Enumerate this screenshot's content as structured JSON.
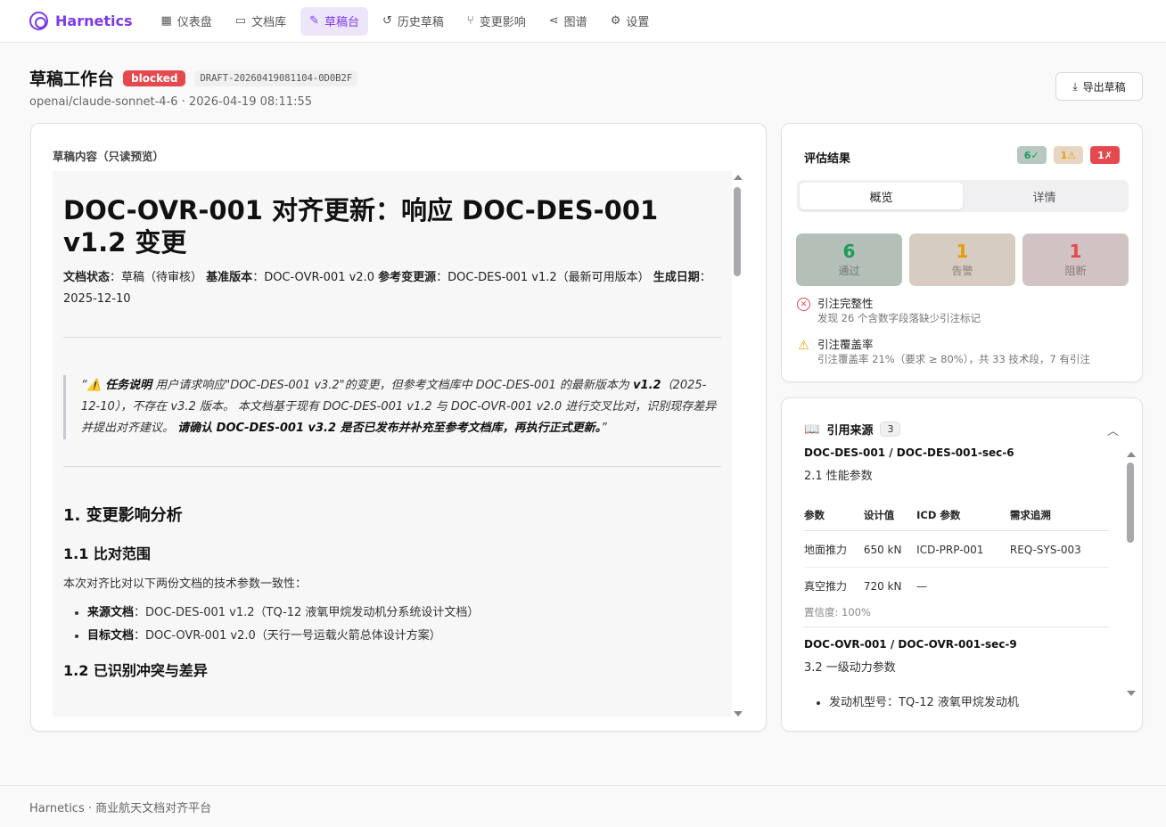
{
  "nav": {
    "brand": "Harnetics",
    "items": [
      {
        "label": "仪表盘",
        "icon": "grid-icon",
        "active": false
      },
      {
        "label": "文档库",
        "icon": "book-icon",
        "active": false
      },
      {
        "label": "草稿台",
        "icon": "draft-icon",
        "active": true
      },
      {
        "label": "历史草稿",
        "icon": "history-icon",
        "active": false
      },
      {
        "label": "变更影响",
        "icon": "branch-icon",
        "active": false
      },
      {
        "label": "图谱",
        "icon": "share-icon",
        "active": false
      },
      {
        "label": "设置",
        "icon": "gear-icon",
        "active": false
      }
    ]
  },
  "header": {
    "title": "草稿工作台",
    "status": "blocked",
    "draft_id": "DRAFT-20260419081104-0D0B2F",
    "subtitle": "openai/claude-sonnet-4-6 · 2026-04-19 08:11:55",
    "export_label": "导出草稿"
  },
  "preview": {
    "label": "草稿内容（只读预览）",
    "h1": "DOC-OVR-001 对齐更新：响应 DOC-DES-001 v1.2 变更",
    "meta": {
      "status_label": "文档状态",
      "status_value": "：草稿（待审核）",
      "base_label": "基准版本",
      "base_value": "：DOC-OVR-001 v2.0",
      "ref_label": "参考变更源",
      "ref_value": "：DOC-DES-001 v1.2（最新可用版本）",
      "date_label": "生成日期",
      "date_value": "：2025-12-10"
    },
    "quote": {
      "open": "“⚠️ ",
      "bold1": "任务说明",
      "text1": " 用户请求响应\"DOC-DES-001 v3.2\"的变更，但参考文档库中 DOC-DES-001 的最新版本为 ",
      "bold2": "v1.2",
      "text2": "（2025-12-10），不存在 v3.2 版本。 本文档基于现有 DOC-DES-001 v1.2 与 DOC-OVR-001 v2.0 进行交叉比对，识别现存差异并提出对齐建议。 ",
      "bold3": "请确认 DOC-DES-001 v3.2 是否已发布并补充至参考文档库，再执行正式更新。",
      "close": "”"
    },
    "h2": "1. 变更影响分析",
    "h3": "1.1 比对范围",
    "para": "本次对齐比对以下两份文档的技术参数一致性：",
    "list": [
      {
        "label": "来源文档",
        "value": "：DOC-DES-001 v1.2（TQ-12 液氧甲烷发动机分系统设计文档）"
      },
      {
        "label": "目标文档",
        "value": "：DOC-OVR-001 v2.0（天行一号运载火箭总体设计方案）"
      }
    ],
    "h3_next": "1.2 已识别冲突与差异"
  },
  "evaluation": {
    "title": "评估结果",
    "chips": {
      "pass": "6✓",
      "warn": "1⚠",
      "block": "1✗"
    },
    "tabs": [
      "概览",
      "详情"
    ],
    "stats": [
      {
        "num": "6",
        "label": "通过",
        "kind": "pass"
      },
      {
        "num": "1",
        "label": "告警",
        "kind": "warn"
      },
      {
        "num": "1",
        "label": "阻断",
        "kind": "block"
      }
    ],
    "issues": [
      {
        "title": "引注完整性",
        "desc": "发现 26 个含数字段落缺少引注标记",
        "kind": "error"
      },
      {
        "title": "引注覆盖率",
        "desc": "引注覆盖率 21%（要求 ≥ 80%），共 33 技术段，7 有引注",
        "kind": "warning"
      }
    ]
  },
  "sources": {
    "title": "引用来源",
    "count": "3",
    "ref1": "DOC-DES-001 / DOC-DES-001-sec-6",
    "sec1": "2.1 性能参数",
    "table": {
      "headers": [
        "参数",
        "设计值",
        "ICD 参数",
        "需求追溯"
      ],
      "rows": [
        [
          "地面推力",
          "650 kN",
          "ICD-PRP-001",
          "REQ-SYS-003"
        ],
        [
          "真空推力",
          "720 kN",
          "—",
          ""
        ]
      ]
    },
    "confidence": "置信度: 100%",
    "ref2": "DOC-OVR-001 / DOC-OVR-001-sec-9",
    "sec2": "3.2 一级动力参数",
    "list": [
      "发动机型号：TQ-12 液氧甲烷发动机"
    ]
  },
  "footer": {
    "text": "Harnetics · 商业航天文档对齐平台"
  },
  "colors": {
    "accent": "#7c3aed",
    "danger": "#e5484d",
    "success": "#1a9b5a",
    "warning": "#e8a100"
  }
}
